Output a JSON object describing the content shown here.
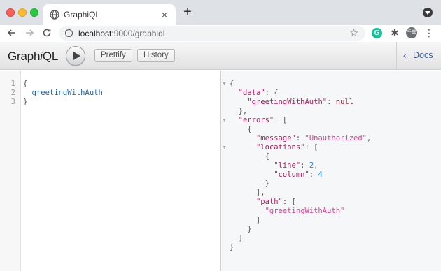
{
  "browser": {
    "tab_title": "GraphiQL",
    "tab_close_glyph": "×",
    "new_tab_glyph": "+",
    "url_host": "localhost",
    "url_path": ":9000/graphiql",
    "profile_label": "千郎",
    "extension_g_label": "G",
    "icons": {
      "back": "arrow-left-icon",
      "forward": "arrow-right-icon",
      "reload": "reload-icon",
      "info": "info-icon",
      "star": "star-icon",
      "extensions": "puzzle-icon",
      "menu": "kebab-menu-icon"
    }
  },
  "toolbar": {
    "title_prefix": "Graph",
    "title_italic": "i",
    "title_suffix": "QL",
    "prettify_label": "Prettify",
    "history_label": "History",
    "docs_label": "Docs",
    "docs_chevron": "‹"
  },
  "query_editor": {
    "line_numbers": [
      "1",
      "2",
      "3"
    ],
    "lines": [
      {
        "text": "{",
        "kind": "punc"
      },
      {
        "text": "  greetingWithAuth",
        "kind": "field"
      },
      {
        "text": "}",
        "kind": "punc"
      }
    ]
  },
  "result_viewer": {
    "lines": [
      {
        "fold": true,
        "tokens": [
          {
            "t": "{",
            "c": "punc"
          }
        ]
      },
      {
        "fold": false,
        "tokens": [
          {
            "t": "  ",
            "c": "punc"
          },
          {
            "t": "\"data\"",
            "c": "key"
          },
          {
            "t": ": {",
            "c": "punc"
          }
        ]
      },
      {
        "fold": false,
        "tokens": [
          {
            "t": "    ",
            "c": "punc"
          },
          {
            "t": "\"greetingWithAuth\"",
            "c": "key"
          },
          {
            "t": ": ",
            "c": "punc"
          },
          {
            "t": "null",
            "c": "kw"
          }
        ]
      },
      {
        "fold": false,
        "tokens": [
          {
            "t": "  },",
            "c": "punc"
          }
        ]
      },
      {
        "fold": true,
        "tokens": [
          {
            "t": "  ",
            "c": "punc"
          },
          {
            "t": "\"errors\"",
            "c": "key"
          },
          {
            "t": ": [",
            "c": "punc"
          }
        ]
      },
      {
        "fold": false,
        "tokens": [
          {
            "t": "    {",
            "c": "punc"
          }
        ]
      },
      {
        "fold": false,
        "tokens": [
          {
            "t": "      ",
            "c": "punc"
          },
          {
            "t": "\"message\"",
            "c": "key"
          },
          {
            "t": ": ",
            "c": "punc"
          },
          {
            "t": "\"Unauthorized\"",
            "c": "str"
          },
          {
            "t": ",",
            "c": "punc"
          }
        ]
      },
      {
        "fold": true,
        "tokens": [
          {
            "t": "      ",
            "c": "punc"
          },
          {
            "t": "\"locations\"",
            "c": "key"
          },
          {
            "t": ": [",
            "c": "punc"
          }
        ]
      },
      {
        "fold": false,
        "tokens": [
          {
            "t": "        {",
            "c": "punc"
          }
        ]
      },
      {
        "fold": false,
        "tokens": [
          {
            "t": "          ",
            "c": "punc"
          },
          {
            "t": "\"line\"",
            "c": "key"
          },
          {
            "t": ": ",
            "c": "punc"
          },
          {
            "t": "2",
            "c": "num"
          },
          {
            "t": ",",
            "c": "punc"
          }
        ]
      },
      {
        "fold": false,
        "tokens": [
          {
            "t": "          ",
            "c": "punc"
          },
          {
            "t": "\"column\"",
            "c": "key"
          },
          {
            "t": ": ",
            "c": "punc"
          },
          {
            "t": "4",
            "c": "num"
          }
        ]
      },
      {
        "fold": false,
        "tokens": [
          {
            "t": "        }",
            "c": "punc"
          }
        ]
      },
      {
        "fold": false,
        "tokens": [
          {
            "t": "      ],",
            "c": "punc"
          }
        ]
      },
      {
        "fold": false,
        "tokens": [
          {
            "t": "      ",
            "c": "punc"
          },
          {
            "t": "\"path\"",
            "c": "key"
          },
          {
            "t": ": [",
            "c": "punc"
          }
        ]
      },
      {
        "fold": false,
        "tokens": [
          {
            "t": "        ",
            "c": "punc"
          },
          {
            "t": "\"greetingWithAuth\"",
            "c": "str"
          }
        ]
      },
      {
        "fold": false,
        "tokens": [
          {
            "t": "      ]",
            "c": "punc"
          }
        ]
      },
      {
        "fold": false,
        "tokens": [
          {
            "t": "    }",
            "c": "punc"
          }
        ]
      },
      {
        "fold": false,
        "tokens": [
          {
            "t": "  ]",
            "c": "punc"
          }
        ]
      },
      {
        "fold": false,
        "tokens": [
          {
            "t": "}",
            "c": "punc"
          }
        ]
      }
    ]
  },
  "colors": {
    "key": "#b11a5e",
    "string": "#d64292",
    "number": "#2882f9",
    "keyword": "#b11a1a",
    "field": "#1f61a0",
    "docs_link": "#3b5998"
  }
}
